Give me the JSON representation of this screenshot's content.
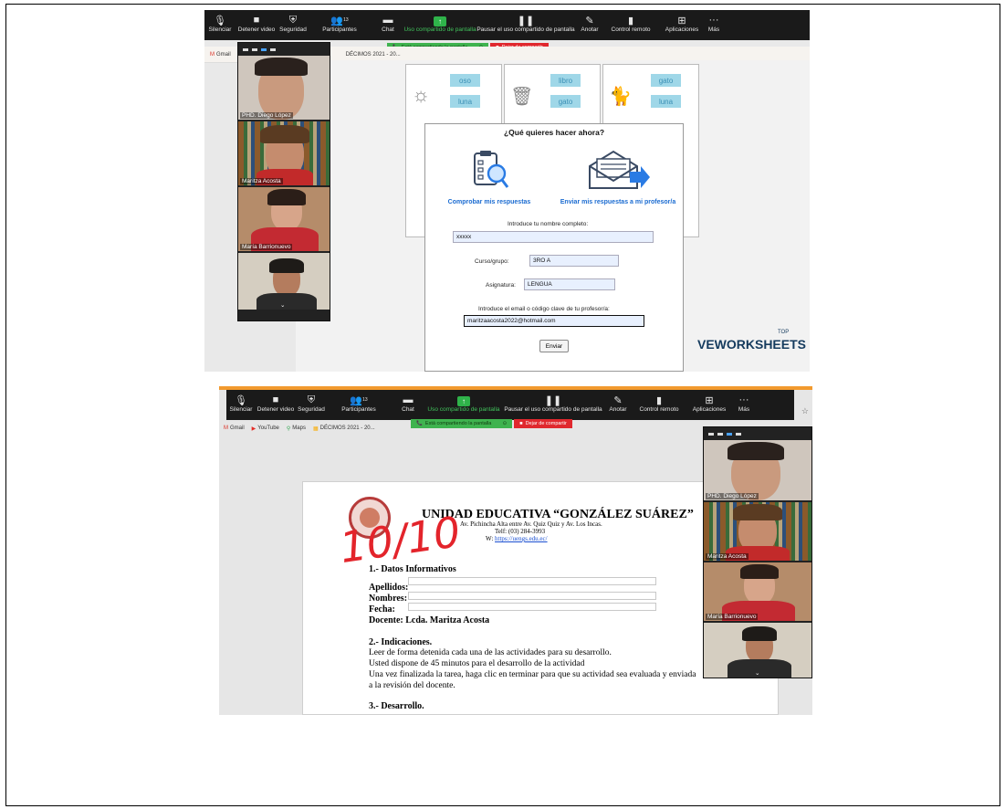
{
  "toolbar": {
    "mute": "Silenciar",
    "stop_video": "Detener video",
    "security": "Seguridad",
    "participants": "Participantes",
    "participant_count": "13",
    "chat": "Chat",
    "share": "Uso compartido de pantalla",
    "pause_share": "Pausar el uso compartido de pantalla",
    "annotate": "Anotar",
    "remote_control": "Control remoto",
    "apps": "Aplicaciones",
    "more": "Más",
    "sharing_label": "Está compartiendo la pantalla",
    "stop_share": "Dejar de compartir"
  },
  "bookmarks": {
    "gmail": "Gmail",
    "youtube": "YouTube",
    "maps": "Maps",
    "decimos": "DÉCIMOS 2021 - 20..."
  },
  "participants": [
    {
      "name": "PHD. Diego López"
    },
    {
      "name": "Maritza Acosta"
    },
    {
      "name": "María Barrionuevo"
    },
    {
      "name": ""
    }
  ],
  "worksheet": {
    "words_col1": [
      "oso",
      "luna"
    ],
    "words_col2": [
      "libro",
      "gato"
    ],
    "words_col3": [
      "gato",
      "luna"
    ],
    "brand": "VEWORKSHEETS",
    "brand_top": "TOP"
  },
  "modal": {
    "title": "¿Qué quieres hacer ahora?",
    "option_check": "Comprobar mis respuestas",
    "option_send": "Enviar mis respuestas a mi profesor/a",
    "name_label": "Introduce tu nombre completo:",
    "name_value": "xxxxx",
    "course_label": "Curso/grupo:",
    "course_value": "3RO A",
    "subject_label": "Asignatura:",
    "subject_value": "LENGUA",
    "email_label": "Introduce el email o código clave de tu profesor/a:",
    "email_value": "maritzaacosta2022@hotmail.com",
    "send_button": "Enviar"
  },
  "document": {
    "school": "UNIDAD EDUCATIVA “GONZÁLEZ SUÁREZ”",
    "address": "Av. Pichincha Alta entre Av. Quiz Quiz y Av. Los Incas.",
    "phone": "Telf: (03) 284-3993",
    "web_prefix": "W:",
    "web": "https://uengs.edu.ec/",
    "grade_mark": "10/10",
    "section1": "1.- Datos Informativos",
    "surnames": "Apellidos:",
    "names": "Nombres:",
    "date": "Fecha:",
    "teacher": "Docente: Lcda. Maritza Acosta",
    "section2": "2.- Indicaciones.",
    "ind1": "Leer de forma detenida cada una de las actividades para su desarrollo.",
    "ind2": "Usted dispone de 45 minutos para el desarrollo de la actividad",
    "ind3": "Una vez finalizada la tarea, haga clic en terminar para que su actividad sea evaluada y enviada",
    "ind4": "a la revisión del docente.",
    "section3": "3.- Desarrollo."
  },
  "colors": {
    "toolbar_bg": "#1a1a1a",
    "share_green": "#3fb34f",
    "stop_red": "#e0282e",
    "link_blue": "#1a6bd1",
    "pen_red": "#e3242b"
  }
}
